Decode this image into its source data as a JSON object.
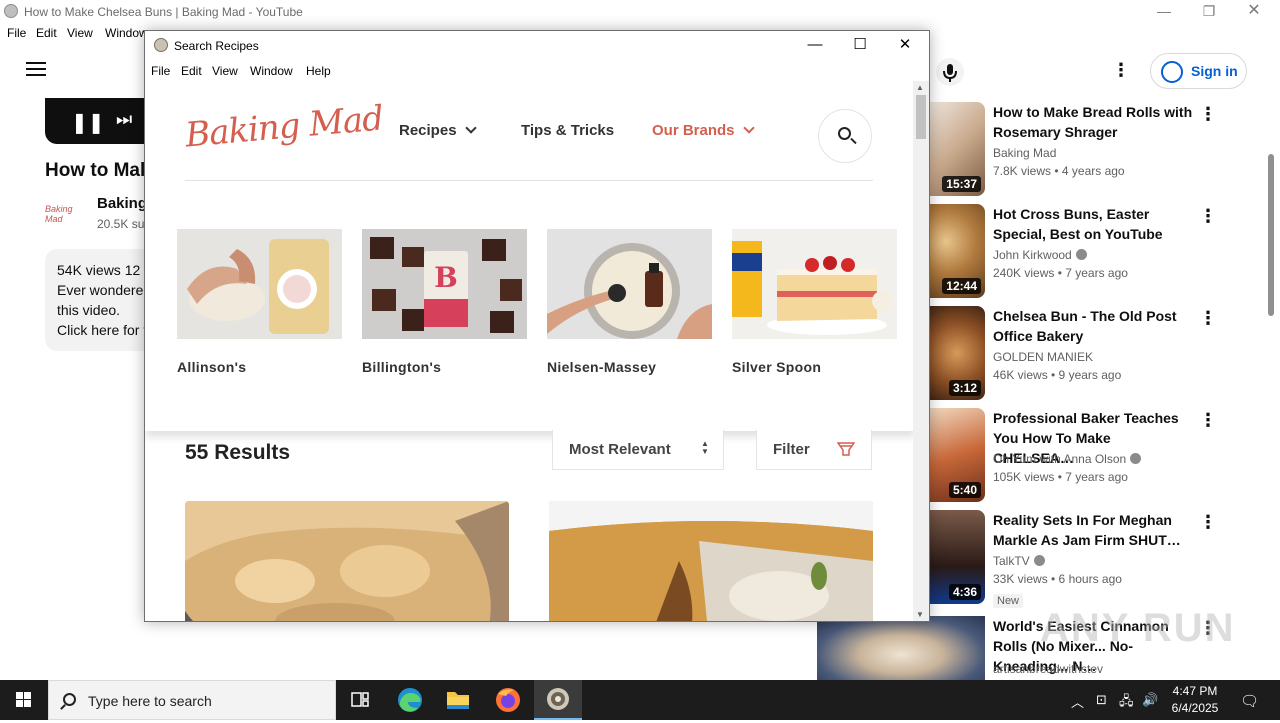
{
  "background_window": {
    "title": "How to Make Chelsea Buns | Baking Mad - YouTube",
    "menu": [
      "File",
      "Edit",
      "View",
      "Window"
    ],
    "video_title": "How to Mal",
    "channel_name": "Baking",
    "subscribers": "20.5K su",
    "channel_logo_text": "Baking Mad",
    "description_lines": [
      "54K views  12",
      "Ever wondered",
      "this video.",
      "Click here for t"
    ],
    "sign_in_label": "Sign in",
    "recommendations": [
      {
        "title": "How to Make Bread Rolls with Rosemary Shrager",
        "channel": "Baking Mad",
        "verified": false,
        "meta": "7.8K views • 4 years ago",
        "duration": "15:37",
        "badge": ""
      },
      {
        "title": "Hot Cross Buns, Easter Special, Best on YouTube",
        "channel": "John Kirkwood",
        "verified": true,
        "meta": "240K views • 7 years ago",
        "duration": "12:44",
        "badge": ""
      },
      {
        "title": "Chelsea Bun - The Old Post Office Bakery",
        "channel": "GOLDEN MANIEK",
        "verified": false,
        "meta": "46K views • 9 years ago",
        "duration": "3:12",
        "badge": ""
      },
      {
        "title": "Professional Baker Teaches You How To Make CHELSEA…",
        "channel": "Oh Yum with Anna Olson",
        "verified": true,
        "meta": "105K views • 7 years ago",
        "duration": "5:40",
        "badge": ""
      },
      {
        "title": "Reality Sets In For Meghan Markle As Jam Firm SHUT…",
        "channel": "TalkTV",
        "verified": true,
        "meta": "33K views • 6 hours ago",
        "duration": "4:36",
        "badge": "New"
      },
      {
        "title": "World's Easiest Cinnamon Rolls (No Mixer... No-Kneading... N…",
        "channel": "artisanbreadwithstev",
        "verified": false,
        "meta": "",
        "duration": "",
        "badge": ""
      }
    ],
    "watermark": "ANY RUN"
  },
  "app_window": {
    "title": "Search Recipes",
    "controls": {
      "minimize": "—",
      "maximize": "☐",
      "close": "✕"
    },
    "menu": [
      "File",
      "Edit",
      "View",
      "Window",
      "Help"
    ]
  },
  "site": {
    "logo": "Baking Mad",
    "nav": {
      "recipes": "Recipes",
      "tips": "Tips & Tricks",
      "brands": "Our Brands"
    },
    "brand_color": "#d45f4f",
    "brands": [
      {
        "name": "Allinson's"
      },
      {
        "name": "Billington's"
      },
      {
        "name": "Nielsen-Massey"
      },
      {
        "name": "Silver Spoon"
      }
    ],
    "results_count": "55 Results",
    "sort_label": "Most Relevant",
    "filter_label": "Filter"
  },
  "taskbar": {
    "search_placeholder": "Type here to search",
    "time": "4:47 PM",
    "date": "6/4/2025",
    "apps": [
      "task-view-icon",
      "edge-icon",
      "file-explorer-icon",
      "firefox-icon",
      "recipes-app-icon"
    ]
  }
}
